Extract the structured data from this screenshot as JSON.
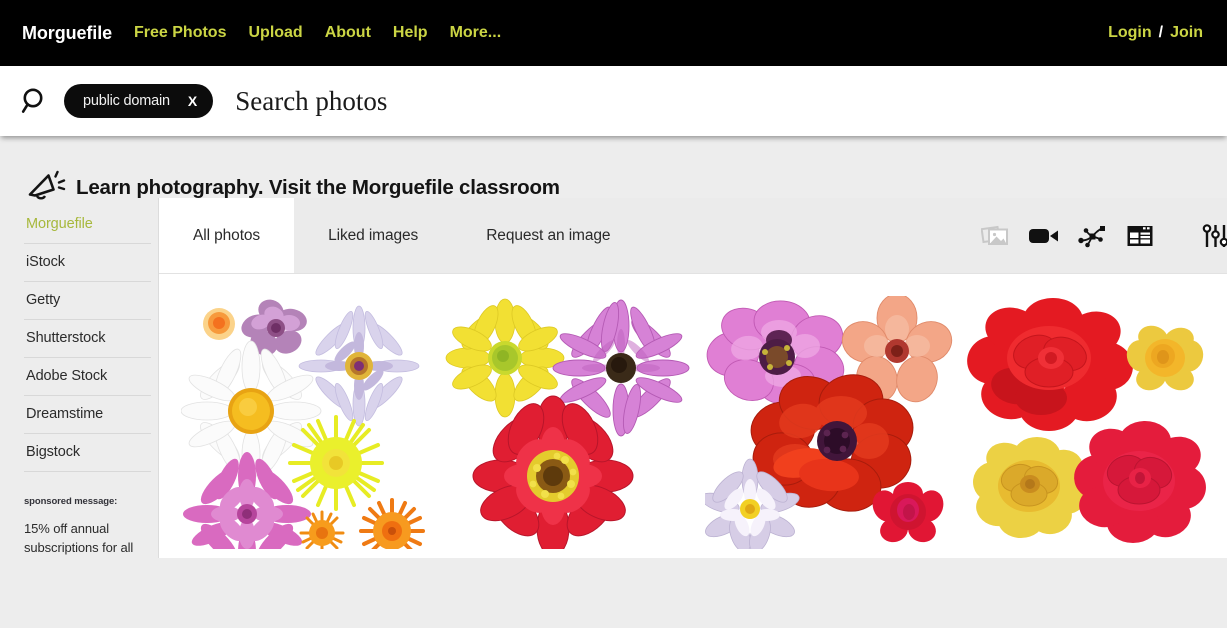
{
  "nav": {
    "brand": "Morguefile",
    "links": [
      {
        "label": "Free Photos"
      },
      {
        "label": "Upload"
      },
      {
        "label": "About"
      },
      {
        "label": "Help"
      },
      {
        "label": "More..."
      }
    ],
    "login": "Login",
    "separator": "/",
    "join": "Join",
    "brand_color": "#ffffff",
    "link_color": "#cbd544",
    "bg_color": "#000000"
  },
  "search": {
    "icon": "search-icon",
    "tag_label": "public domain",
    "tag_remove": "X",
    "placeholder": "Search photos"
  },
  "promo": {
    "icon": "megaphone-icon",
    "text": "Learn photography. Visit the Morguefile classroom"
  },
  "sidebar": {
    "items": [
      {
        "label": "Morguefile",
        "active": true
      },
      {
        "label": "iStock",
        "active": false
      },
      {
        "label": "Getty",
        "active": false
      },
      {
        "label": "Shutterstock",
        "active": false
      },
      {
        "label": "Adobe Stock",
        "active": false
      },
      {
        "label": "Dreamstime",
        "active": false
      },
      {
        "label": "Bigstock",
        "active": false
      }
    ],
    "active_color": "#a7b83c",
    "sponsor_label": "sponsored message:",
    "sponsor_text": "15% off annual subscriptions for all"
  },
  "tabs": [
    {
      "label": "All photos",
      "active": true
    },
    {
      "label": "Liked images",
      "active": false
    },
    {
      "label": "Request an image",
      "active": false
    }
  ],
  "tools": [
    {
      "name": "photos-icon",
      "state": "inactive"
    },
    {
      "name": "video-camera-icon",
      "state": "active"
    },
    {
      "name": "vector-path-icon",
      "state": "active"
    },
    {
      "name": "layout-icon",
      "state": "active"
    },
    {
      "name": "filter-sliders-icon",
      "state": "active"
    }
  ],
  "results": [
    {
      "alt": "Collage of mixed flowers: daisy, dandelion, dahlia, water lily"
    },
    {
      "alt": "Yellow daisy, pink osteospermum and red zinnia"
    },
    {
      "alt": "Pink poppy, peach hibiscus, red poppy, water lily and red rose"
    },
    {
      "alt": "Red and yellow roses"
    }
  ]
}
